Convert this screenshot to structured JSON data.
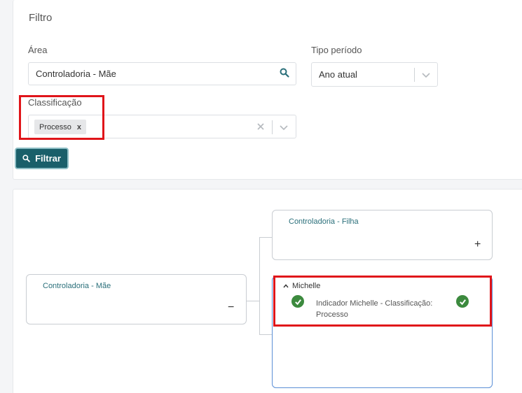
{
  "filter": {
    "title": "Filtro",
    "area_label": "Área",
    "area_value": "Controladoria - Mãe",
    "period_label": "Tipo período",
    "period_value": "Ano atual",
    "class_label": "Classificação",
    "class_chip": "Processo",
    "chip_remove": "x",
    "filter_button": "Filtrar"
  },
  "tree": {
    "root": {
      "title": "Controladoria - Mãe",
      "toggle": "−"
    },
    "child1": {
      "title": "Controladoria - Filha",
      "toggle": "+"
    },
    "child2": {
      "owner": "Michelle",
      "indicator": "Indicador Michelle - Classificação: Processo"
    }
  },
  "colors": {
    "accent": "#1a5f6a",
    "node_title": "#2a6f7a",
    "highlight": "#e0151a",
    "check": "#3c8a3e"
  }
}
